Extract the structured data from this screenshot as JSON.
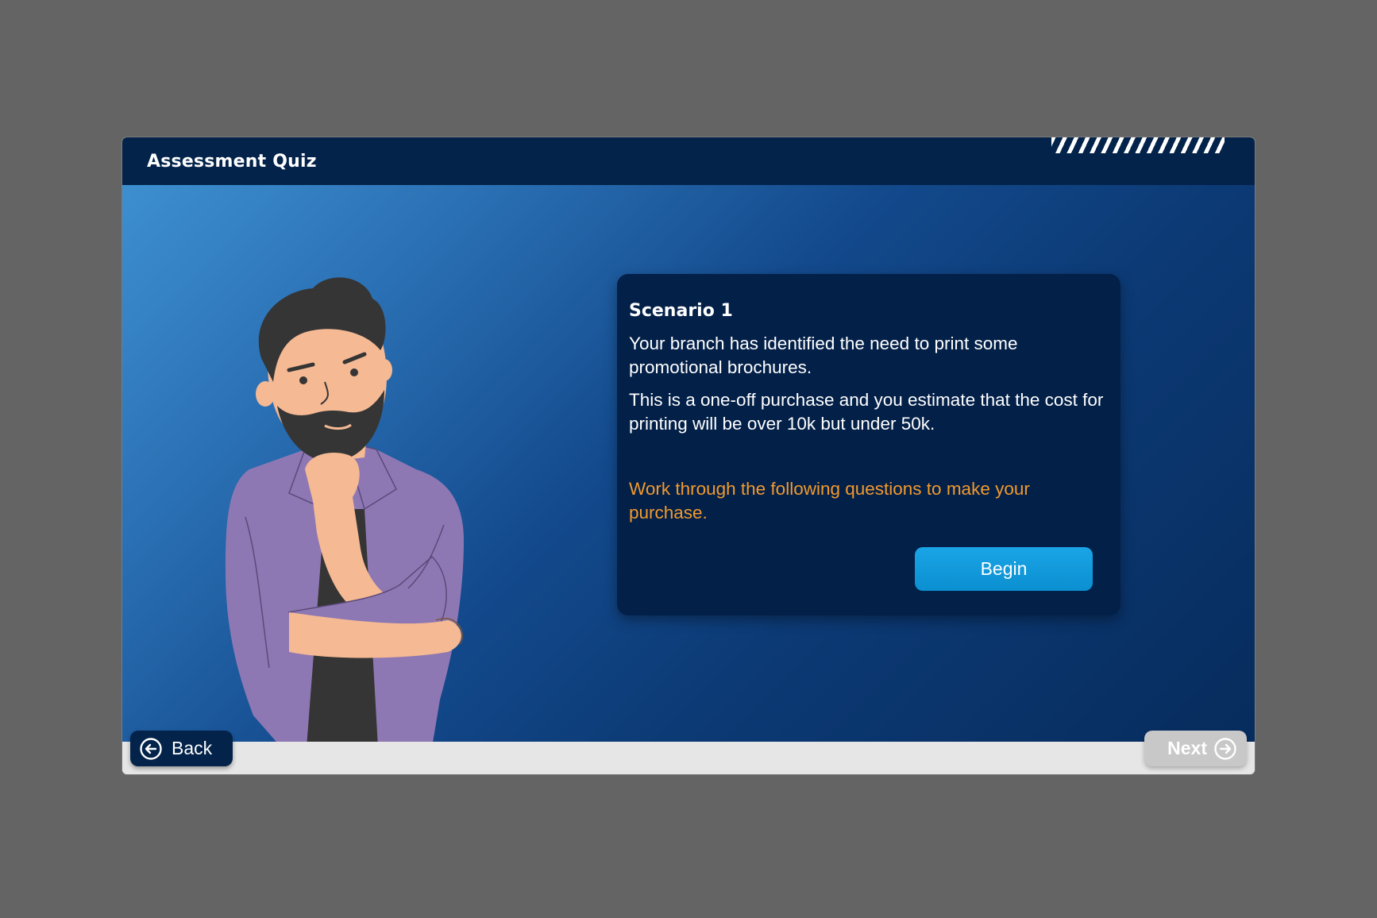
{
  "header": {
    "title": "Assessment Quiz"
  },
  "scenario": {
    "title": "Scenario 1",
    "paragraph_1": "Your branch has identified the need to print some promotional brochures.",
    "paragraph_2": "This is a one-off purchase and you estimate that the cost for printing will be over 10k but under 50k.",
    "instruction": "Work through the following questions to make your purchase.",
    "begin_label": "Begin"
  },
  "navigation": {
    "back_label": "Back",
    "back_icon": "arrow-left-circle-icon",
    "next_label": "Next",
    "next_icon": "arrow-right-circle-icon"
  },
  "colors": {
    "header_bg": "#03234a",
    "card_bg": "#032048",
    "accent_orange": "#f29a2e",
    "begin_button": "#0b8fd1",
    "next_disabled": "#c8c8c8"
  }
}
